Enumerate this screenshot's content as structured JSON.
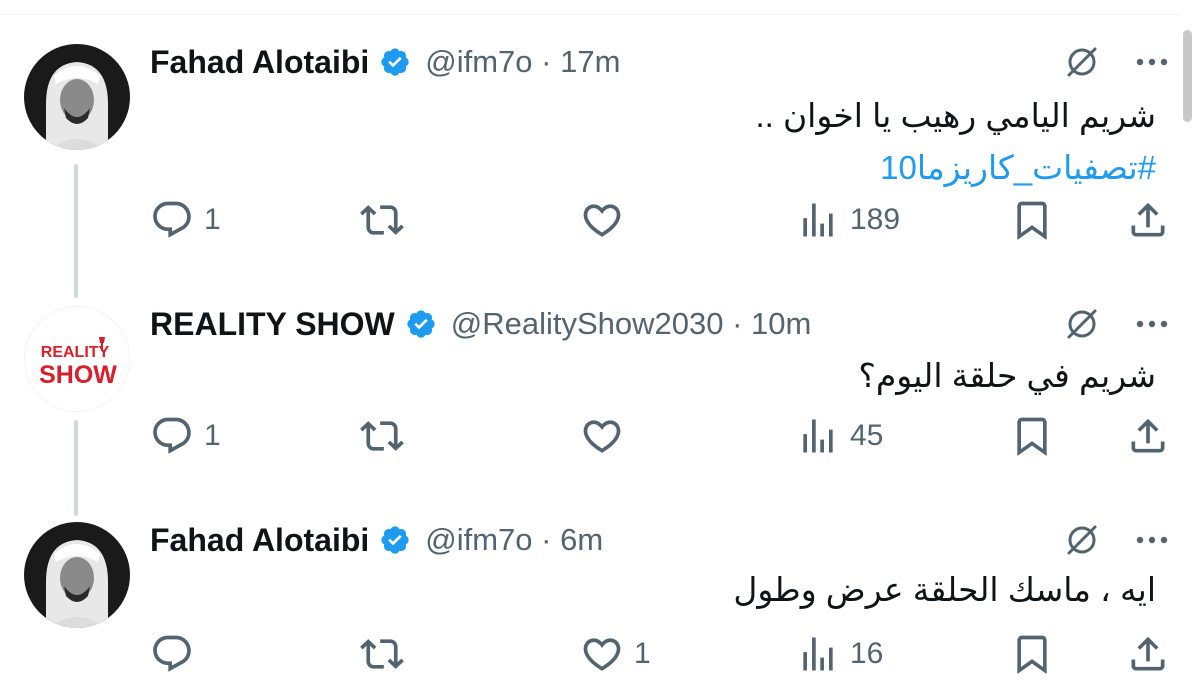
{
  "tweets": [
    {
      "author": "Fahad Alotaibi",
      "handle": "@ifm7o",
      "time": "17m",
      "meta": "@ifm7o · 17m",
      "avatar": "person-photo",
      "verified": true,
      "text_line1": "شريم اليامي رهيب يا اخوان ..",
      "hashtag": "#تصفيات_كاريزما10",
      "replies": "1",
      "retweets": "",
      "likes": "",
      "views": "189"
    },
    {
      "author": "REALITY SHOW",
      "handle": "@RealityShow2030",
      "time": "10m",
      "meta": "@RealityShow2030 · 10m",
      "avatar": "reality-show-logo",
      "avatar_logo_line1": "REALITY",
      "avatar_logo_line2": "SHOW",
      "verified": true,
      "text_line1": "شريم في حلقة اليوم؟",
      "replies": "1",
      "retweets": "",
      "likes": "",
      "views": "45"
    },
    {
      "author": "Fahad Alotaibi",
      "handle": "@ifm7o",
      "time": "6m",
      "meta": "@ifm7o · 6m",
      "avatar": "person-photo",
      "verified": true,
      "text_line1": "ايه ، ماسك الحلقة عرض وطول",
      "replies": "",
      "retweets": "",
      "likes": "1",
      "views": "16"
    }
  ],
  "icons": {
    "verified": "verified-badge-icon",
    "grok": "grok-icon",
    "more": "more-options-icon",
    "reply": "reply-icon",
    "retweet": "retweet-icon",
    "like": "like-icon",
    "views": "views-icon",
    "bookmark": "bookmark-icon",
    "share": "share-icon"
  },
  "colors": {
    "text": "#0f1419",
    "secondary": "#536471",
    "link": "#1d9bf0",
    "verified": "#1d9bf0",
    "thread_line": "#cfd9de",
    "logo_red": "#d91f2a"
  }
}
